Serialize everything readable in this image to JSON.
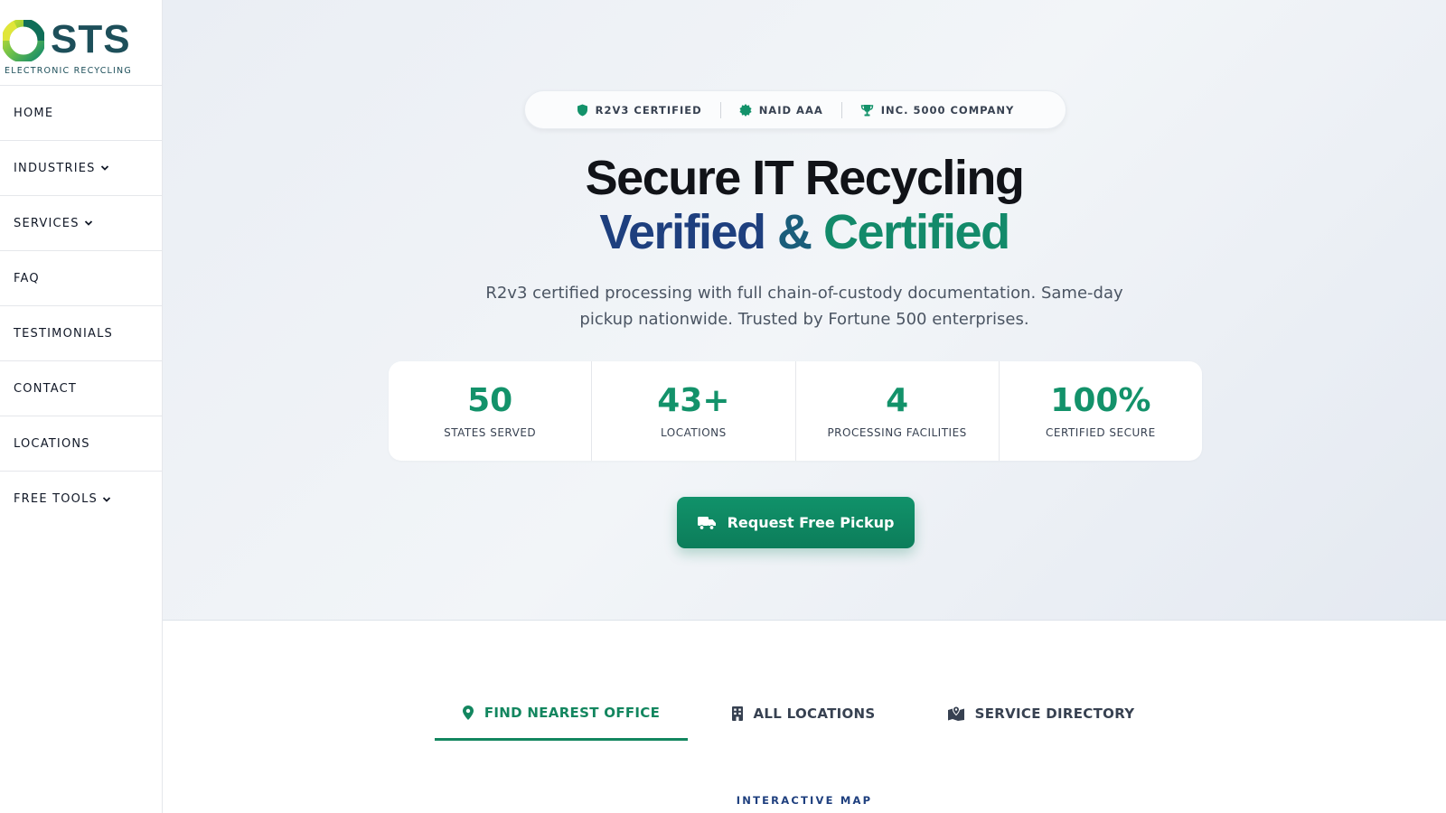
{
  "brand": {
    "name": "STS",
    "tagline": "ELECTRONIC RECYCLING"
  },
  "nav": [
    {
      "label": "HOME",
      "has_dropdown": false
    },
    {
      "label": "INDUSTRIES",
      "has_dropdown": true
    },
    {
      "label": "SERVICES",
      "has_dropdown": true
    },
    {
      "label": "FAQ",
      "has_dropdown": false
    },
    {
      "label": "TESTIMONIALS",
      "has_dropdown": false
    },
    {
      "label": "CONTACT",
      "has_dropdown": false
    },
    {
      "label": "LOCATIONS",
      "has_dropdown": false
    },
    {
      "label": "FREE TOOLS",
      "has_dropdown": true
    }
  ],
  "hero": {
    "badges": [
      {
        "label": "R2V3 CERTIFIED",
        "icon": "shield-icon"
      },
      {
        "label": "NAID AAA",
        "icon": "certificate-icon"
      },
      {
        "label": "INC. 5000 COMPANY",
        "icon": "trophy-icon"
      }
    ],
    "title_line1": "Secure IT Recycling",
    "title_line2_part1": "Verified",
    "title_line2_amp": "&",
    "title_line2_part2": "Certified",
    "lead": "R2v3 certified processing with full chain-of-custody documentation. Same-day pickup nationwide. Trusted by Fortune 500 enterprises.",
    "stats": [
      {
        "value": "50",
        "label": "STATES SERVED"
      },
      {
        "value": "43+",
        "label": "LOCATIONS"
      },
      {
        "value": "4",
        "label": "PROCESSING FACILITIES"
      },
      {
        "value": "100%",
        "label": "CERTIFIED SECURE"
      }
    ],
    "cta_label": "Request Free Pickup",
    "cta_icon": "truck-icon"
  },
  "tabs": [
    {
      "label": "FIND NEAREST OFFICE",
      "icon": "map-pin-icon",
      "active": true
    },
    {
      "label": "ALL LOCATIONS",
      "icon": "building-icon",
      "active": false
    },
    {
      "label": "SERVICE DIRECTORY",
      "icon": "map-location-icon",
      "active": false
    }
  ],
  "section": {
    "eyebrow": "INTERACTIVE MAP"
  },
  "colors": {
    "brand_green": "#13926a",
    "brand_navy": "#1e3f7e",
    "logo_teal": "#1d4f5a",
    "hero_bg": "#eef2f6"
  }
}
